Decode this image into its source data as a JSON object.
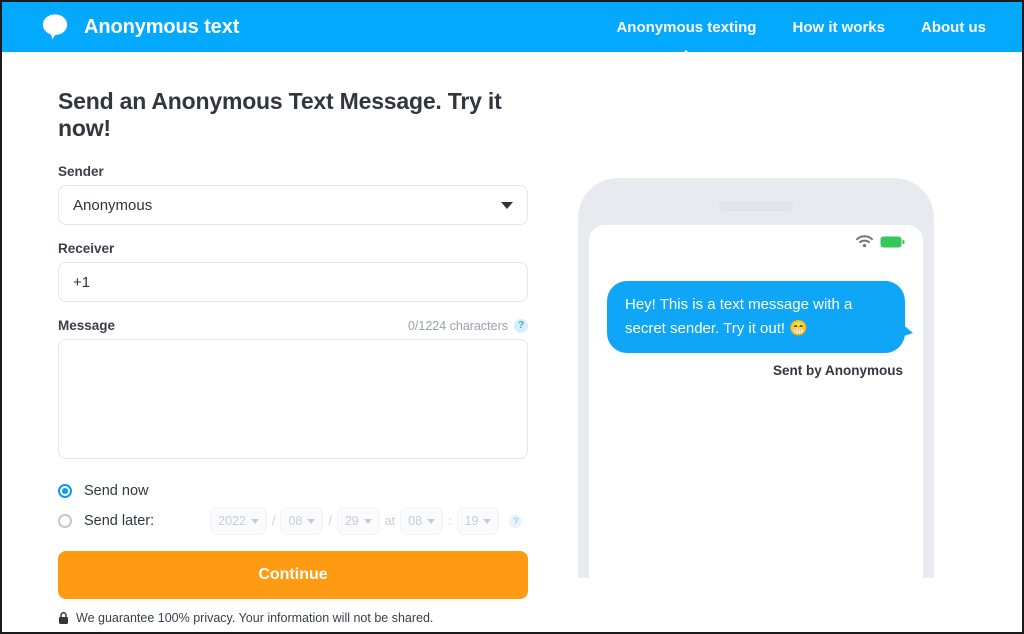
{
  "header": {
    "brand_name": "Anonymous text",
    "brand_icon": "speech-bubble-icon",
    "nav": [
      {
        "label": "Anonymous texting",
        "active": true
      },
      {
        "label": "How it works",
        "active": false
      },
      {
        "label": "About us",
        "active": false
      }
    ]
  },
  "form": {
    "title": "Send an Anonymous Text Message. Try it now!",
    "sender": {
      "label": "Sender",
      "value": "Anonymous",
      "options": [
        "Anonymous"
      ]
    },
    "receiver": {
      "label": "Receiver",
      "value": "+1"
    },
    "message": {
      "label": "Message",
      "char_count": "0/1224 characters",
      "help": "?",
      "value": ""
    },
    "schedule": {
      "send_now_label": "Send now",
      "send_later_label": "Send later:",
      "selected": "send_now",
      "year": "2022",
      "month": "08",
      "day": "29",
      "at_label": "at",
      "hour": "08",
      "minute": "19",
      "sep_slash": "/",
      "sep_colon": ":",
      "help": "?"
    },
    "continue_label": "Continue",
    "privacy_text": "We guarantee 100% privacy. Your information will not be shared."
  },
  "phone": {
    "status": {
      "wifi_icon": "wifi-icon",
      "battery_icon": "battery-icon"
    },
    "message_text": "Hey! This is a text message with a secret sender. Try it out!",
    "message_emoji": "😁",
    "sent_by": "Sent by Anonymous"
  },
  "colors": {
    "brand_blue": "#03a9ff",
    "bubble_blue": "#0fa6f8",
    "accent_orange": "#ff9b12",
    "battery_green": "#34c759"
  }
}
